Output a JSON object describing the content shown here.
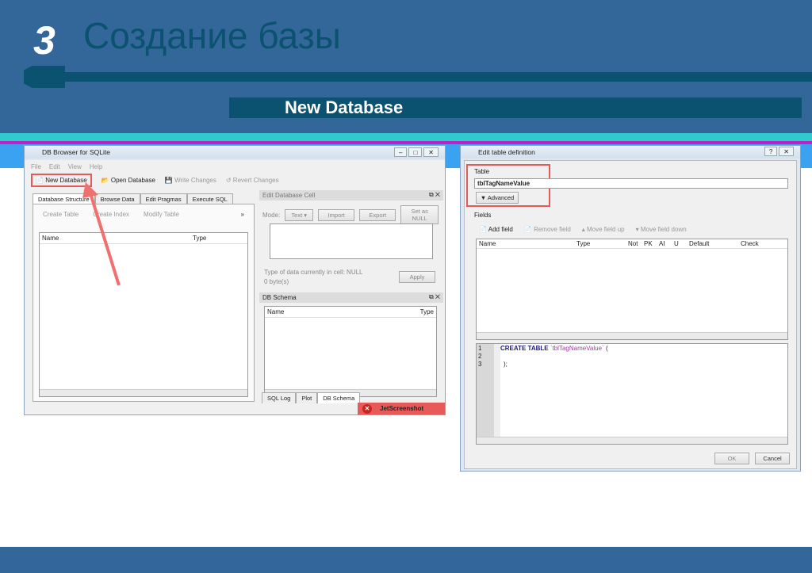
{
  "slide": {
    "number": "3",
    "title": "Создание базы",
    "subtitle": "New Database"
  },
  "main_window": {
    "title": "DB Browser for SQLite",
    "menu": [
      "File",
      "Edit",
      "View",
      "Help"
    ],
    "toolbar": [
      "New Database",
      "Open Database",
      "Write Changes",
      "Revert Changes"
    ],
    "tabs": [
      "Database Structure",
      "Browse Data",
      "Edit Pragmas",
      "Execute SQL"
    ],
    "structure_toolbar": [
      "Create Table",
      "Create Index",
      "Modify Table",
      "»"
    ],
    "columns": [
      "Name",
      "Type"
    ],
    "edit_cell": {
      "title": "Edit Database Cell",
      "mode_label": "Mode:",
      "mode_value": "Text",
      "import": "Import",
      "export": "Export",
      "set_null": "Set as NULL",
      "type_info": "Type of data currently in cell: NULL",
      "size": "0 byte(s)",
      "apply": "Apply"
    },
    "schema": {
      "title": "DB Schema",
      "columns": [
        "Name",
        "Type"
      ]
    },
    "bottom_tabs": [
      "SQL Log",
      "Plot",
      "DB Schema"
    ],
    "toast": "JetScreenshot"
  },
  "dialog": {
    "title": "Edit table definition",
    "table_label": "Table",
    "table_name": "tblTagNameValue",
    "advanced": "Advanced",
    "fields_label": "Fields",
    "field_toolbar": [
      "Add field",
      "Remove field",
      "Move field up",
      "Move field down"
    ],
    "columns": [
      "Name",
      "Type",
      "Not",
      "PK",
      "AI",
      "U",
      "Default",
      "Check"
    ],
    "sql_lines": [
      "1",
      "2",
      "3"
    ],
    "sql_keyword": "CREATE TABLE",
    "sql_name": "`tblTagNameValue`",
    "sql_open": "(",
    "sql_close": ");",
    "ok": "OK",
    "cancel": "Cancel"
  }
}
